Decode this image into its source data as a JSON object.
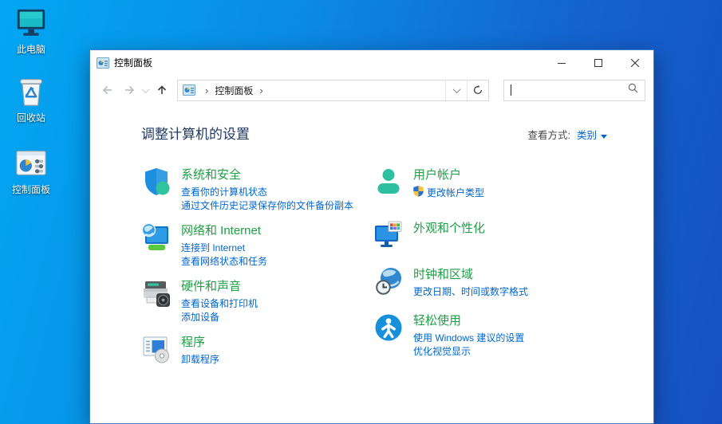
{
  "desktop": {
    "icons": [
      {
        "label": "此电脑"
      },
      {
        "label": "回收站"
      },
      {
        "label": "控制面板"
      }
    ]
  },
  "window": {
    "title": "控制面板",
    "breadcrumb": {
      "sep": "›",
      "item": "控制面板"
    },
    "search": {
      "placeholder": ""
    },
    "header": {
      "title": "调整计算机的设置",
      "view_by_label": "查看方式:",
      "view_by_value": "类别"
    },
    "categories": {
      "left": [
        {
          "title": "系统和安全",
          "links": [
            "查看你的计算机状态",
            "通过文件历史记录保存你的文件备份副本"
          ]
        },
        {
          "title": "网络和 Internet",
          "links": [
            "连接到 Internet",
            "查看网络状态和任务"
          ]
        },
        {
          "title": "硬件和声音",
          "links": [
            "查看设备和打印机",
            "添加设备"
          ]
        },
        {
          "title": "程序",
          "links": [
            "卸载程序"
          ]
        }
      ],
      "right": [
        {
          "title": "用户帐户",
          "links": [
            "更改帐户类型"
          ]
        },
        {
          "title": "外观和个性化",
          "links": []
        },
        {
          "title": "时钟和区域",
          "links": [
            "更改日期、时间或数字格式"
          ]
        },
        {
          "title": "轻松使用",
          "links": [
            "使用 Windows 建议的设置",
            "优化视觉显示"
          ]
        }
      ]
    }
  },
  "colors": {
    "category_title": "#1f9e45",
    "link": "#0066cc",
    "header_title": "#213a63",
    "desktop_gradient_left": "#02a7f2",
    "desktop_gradient_right": "#1550c2"
  }
}
